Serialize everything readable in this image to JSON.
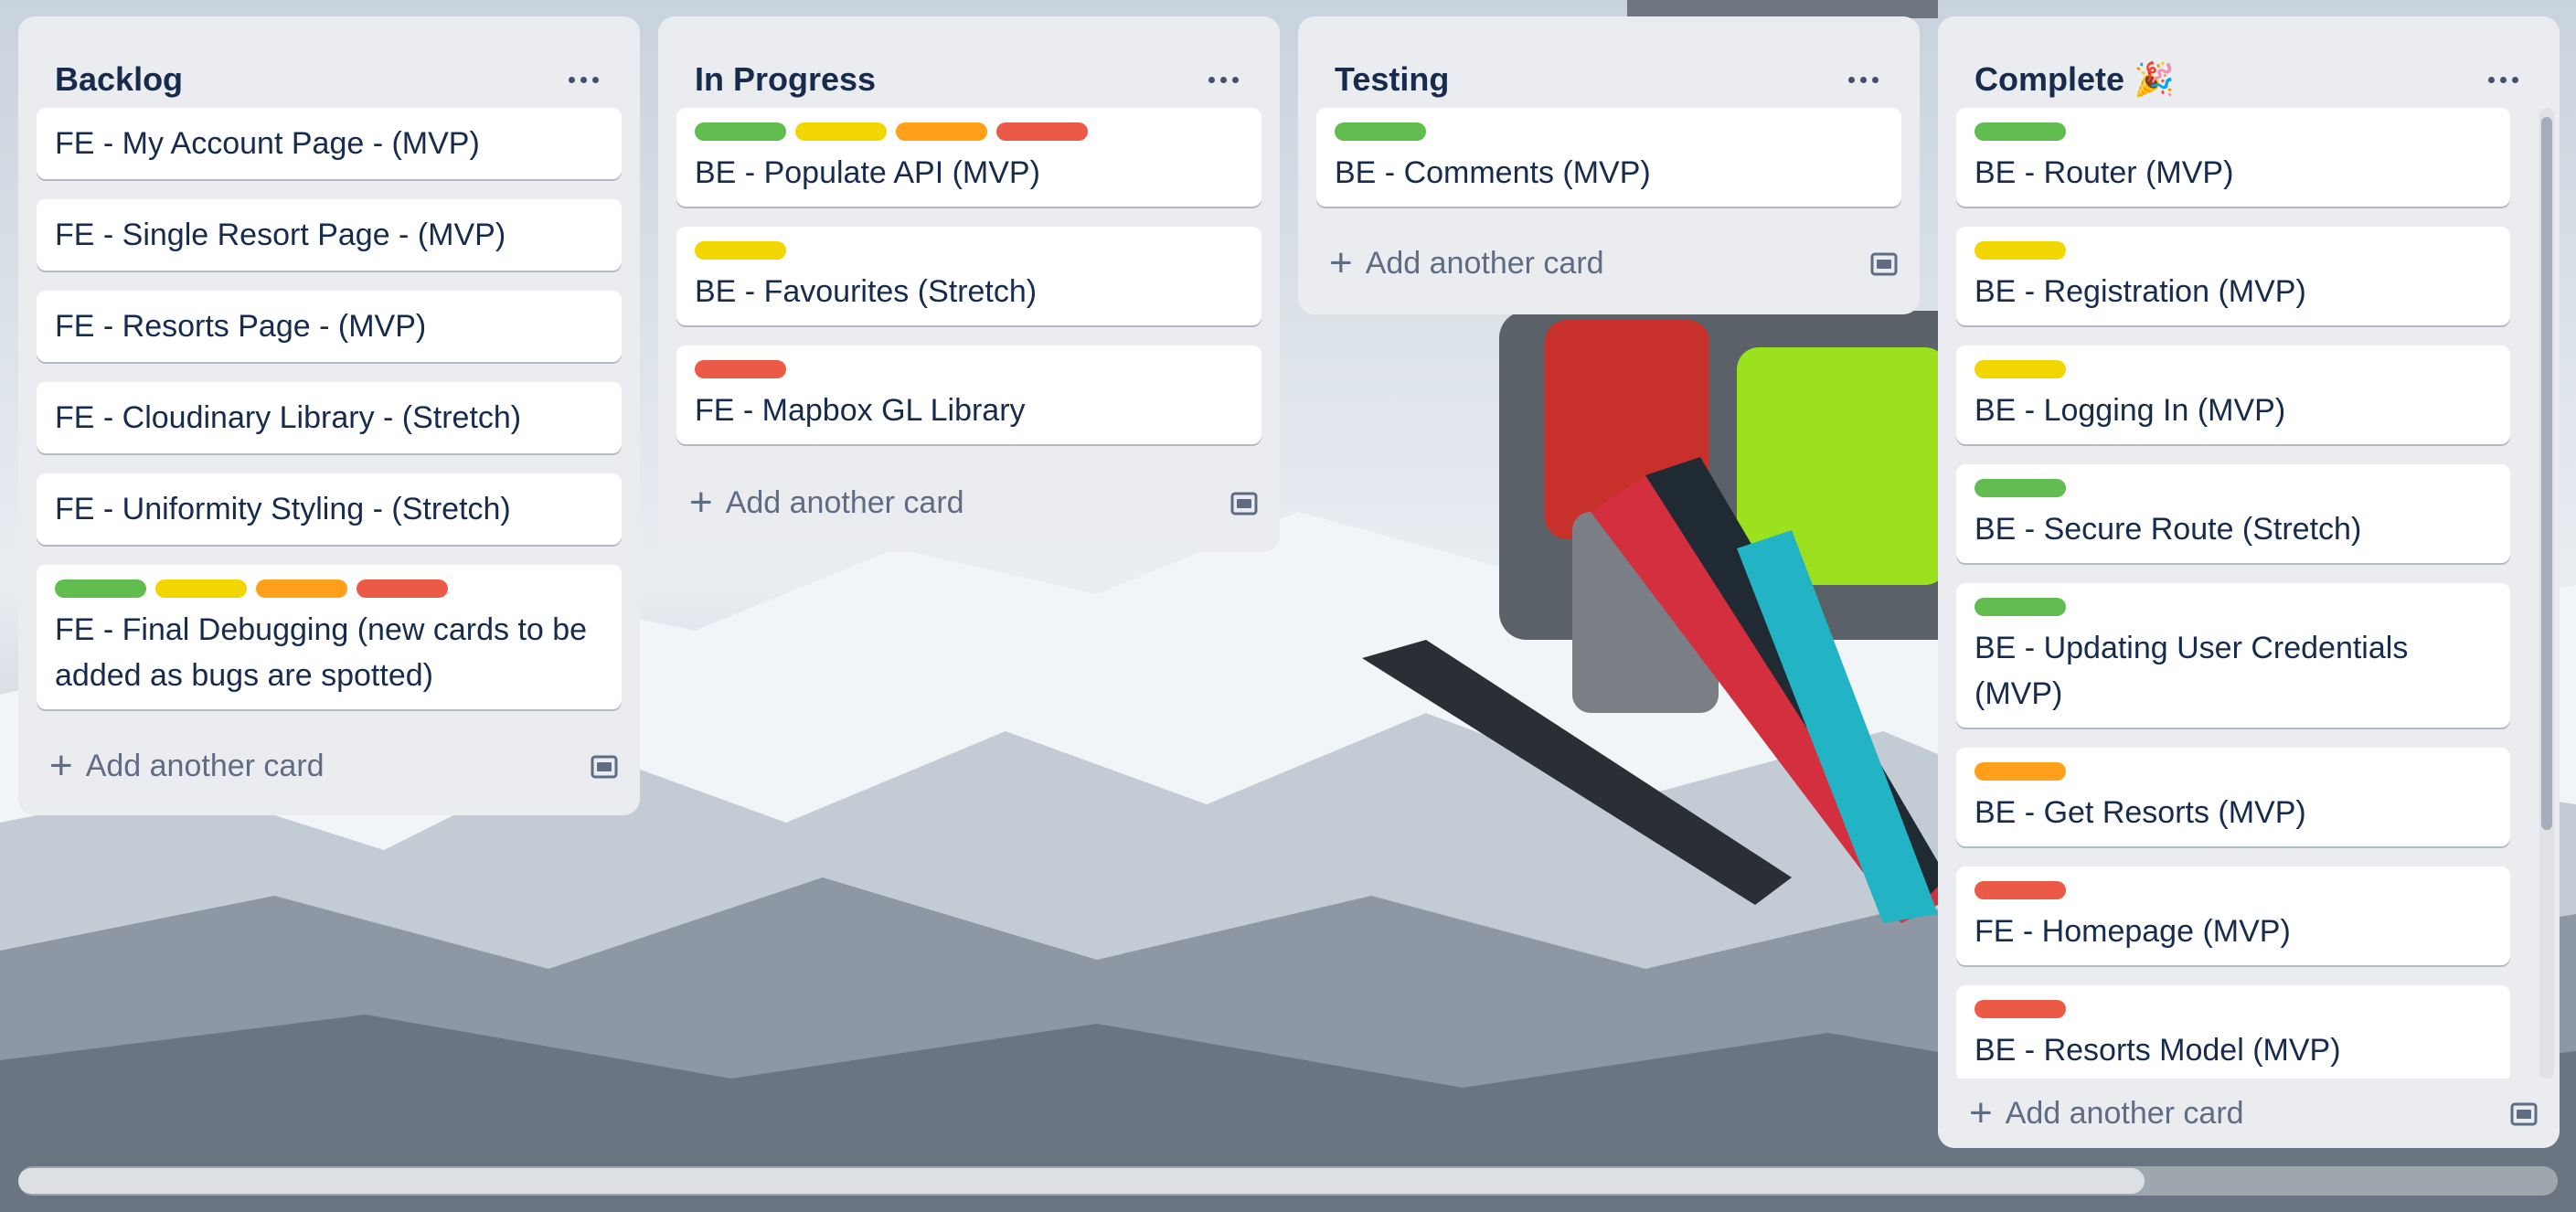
{
  "board": {
    "lists": [
      {
        "title": "Backlog",
        "cards": [
          {
            "title": "FE - My Account Page - (MVP)"
          },
          {
            "title": "FE - Single Resort Page - (MVP)"
          },
          {
            "title": "FE - Resorts Page - (MVP)"
          },
          {
            "title": "FE - Cloudinary Library - (Stretch)"
          },
          {
            "title": "FE - Uniformity Styling - (Stretch)"
          },
          {
            "title": "FE - Final Debugging (new cards to be added as bugs are spotted)",
            "labels": [
              "green",
              "yellow",
              "orange",
              "red"
            ]
          }
        ],
        "add_card": "Add another card"
      },
      {
        "title": "In Progress",
        "cards": [
          {
            "title": "BE - Populate API (MVP)",
            "labels": [
              "green",
              "yellow",
              "orange",
              "red"
            ]
          },
          {
            "title": "BE - Favourites (Stretch)",
            "labels": [
              "yellow"
            ]
          },
          {
            "title": "FE - Mapbox GL Library",
            "labels": [
              "red"
            ]
          }
        ],
        "add_card": "Add another card"
      },
      {
        "title": "Testing",
        "cards": [
          {
            "title": "BE - Comments (MVP)",
            "labels": [
              "green"
            ]
          }
        ],
        "add_card": "Add another card"
      },
      {
        "title": "Complete 🎉",
        "cards": [
          {
            "title": "BE - Router (MVP)",
            "labels": [
              "green"
            ]
          },
          {
            "title": "BE - Registration (MVP)",
            "labels": [
              "yellow"
            ]
          },
          {
            "title": "BE - Logging In (MVP)",
            "labels": [
              "yellow"
            ]
          },
          {
            "title": "BE - Secure Route (Stretch)",
            "labels": [
              "green"
            ]
          },
          {
            "title": "BE - Updating User Credentials (MVP)",
            "labels": [
              "green"
            ]
          },
          {
            "title": "BE - Get Resorts (MVP)",
            "labels": [
              "orange"
            ]
          },
          {
            "title": "FE - Homepage (MVP)",
            "labels": [
              "red"
            ]
          },
          {
            "title": "BE - Resorts Model (MVP)",
            "labels": [
              "red"
            ]
          }
        ],
        "add_card": "Add another card"
      }
    ]
  },
  "colors": {
    "label_green": "#61bd4f",
    "label_yellow": "#f2d600",
    "label_orange": "#ff9f1a",
    "label_red": "#eb5a46",
    "list_bg": "#ebecf0",
    "card_bg": "#ffffff",
    "text": "#172b4d"
  },
  "icons": {
    "list_menu": "ellipsis-icon",
    "add_card": "plus-icon",
    "template": "card-template-icon"
  }
}
